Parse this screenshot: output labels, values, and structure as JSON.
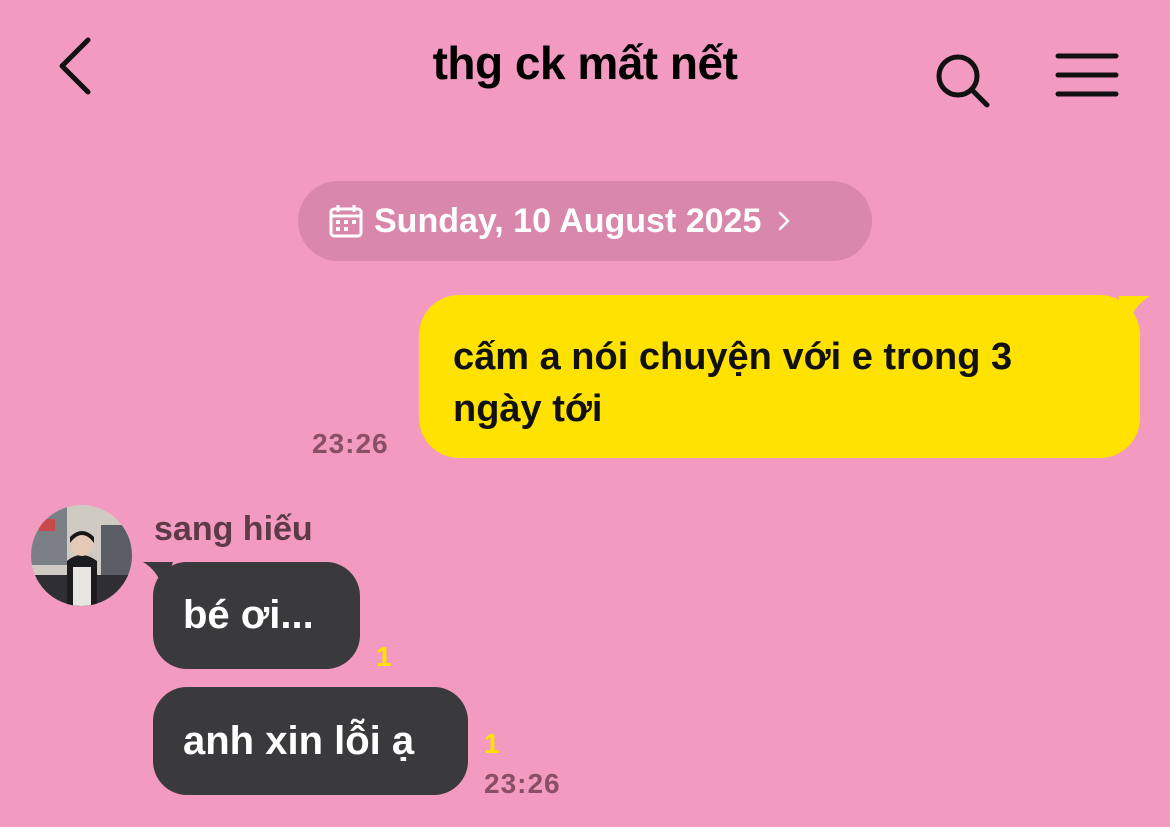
{
  "header": {
    "title": "thg ck mất nết",
    "back_icon": "chevron-left-icon",
    "search_icon": "search-icon",
    "menu_icon": "hamburger-menu-icon"
  },
  "date_divider": {
    "text": "Sunday, 10 August 2025",
    "icon": "calendar-icon"
  },
  "messages": [
    {
      "direction": "outgoing",
      "text_line1": "cấm a nói chuyện với e trong 3",
      "text_line2": "ngày tới",
      "time": "23:26"
    },
    {
      "direction": "incoming",
      "sender": "sang hiếu",
      "text": "bé ơi...",
      "unread": "1"
    },
    {
      "direction": "incoming",
      "text": "anh xin lỗi ạ",
      "unread": "1",
      "time": "23:26"
    }
  ],
  "colors": {
    "background": "#f29ac0",
    "outgoing_bubble": "#ffe200",
    "incoming_bubble": "#3a393b",
    "date_pill": "#d987aa",
    "unread_count": "#ffe200"
  }
}
